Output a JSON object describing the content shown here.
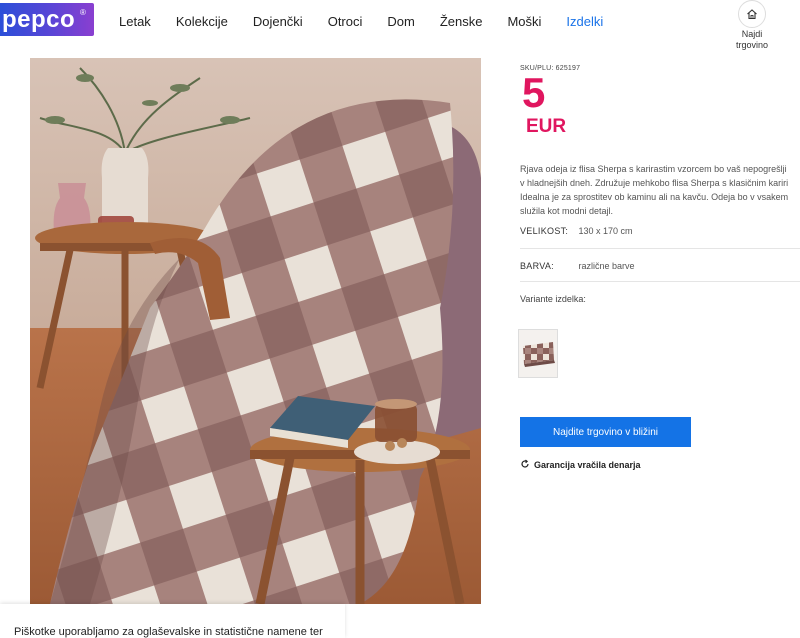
{
  "header": {
    "logo_text": "pepco",
    "logo_mark": "®",
    "nav": [
      "Letak",
      "Kolekcije",
      "Dojenčki",
      "Otroci",
      "Dom",
      "Ženske",
      "Moški",
      "Izdelki"
    ],
    "active_nav": "Izdelki",
    "store_finder": {
      "label_line1": "Najdi",
      "label_line2": "trgovino",
      "icon": "house-icon"
    }
  },
  "product": {
    "sku": "SKU/PLU: 625197",
    "price": "5",
    "currency": "EUR",
    "description_lines": [
      "Rjava odeja iz flisa Sherpa s karirastim vzorcem bo vaš nepogrešlji",
      "v hladnejših dneh. Združuje mehkobo flisa Sherpa s klasičnim kariri",
      "Idealna je za sprostitev ob kaminu ali na kavču. Odeja bo v vsakem",
      "služila kot modni detajl."
    ],
    "attributes": [
      {
        "key": "VELIKOST:",
        "value": "130 x 170 cm"
      },
      {
        "key": "BARVA:",
        "value": "različne barve"
      }
    ],
    "variants_label": "Variante izdelka:",
    "cta_label": "Najdite trgovino v bližini",
    "guarantee_label": "Garancija vračila denarja"
  },
  "cookie": {
    "text": "Piškotke uporabljamo za oglaševalske in statistične namene ter"
  },
  "colors": {
    "brand_blue": "#1473e6",
    "price_pink": "#e0165f",
    "nav_active": "#1a73e8"
  }
}
